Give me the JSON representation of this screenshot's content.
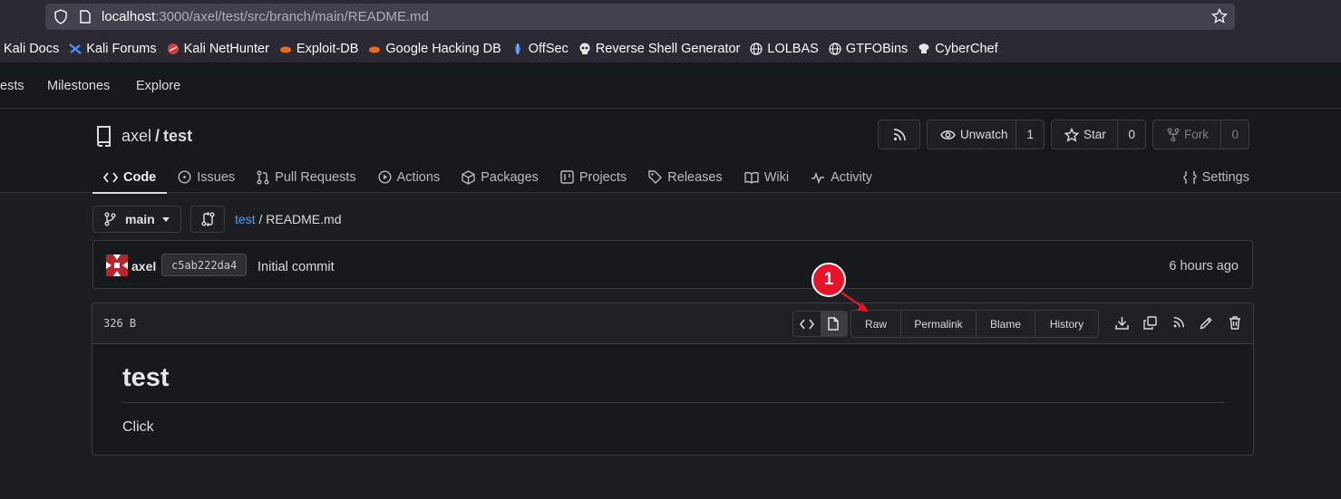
{
  "browser": {
    "url_host": "localhost",
    "url_path": ":3000/axel/test/src/branch/main/README.md",
    "bookmarks": [
      {
        "label": "Kali Docs",
        "icon": "kali-icon"
      },
      {
        "label": "Kali Forums",
        "icon": "kali-icon"
      },
      {
        "label": "Kali NetHunter",
        "icon": "nethunter-icon"
      },
      {
        "label": "Exploit-DB",
        "icon": "exploitdb-icon"
      },
      {
        "label": "Google Hacking DB",
        "icon": "exploitdb-icon"
      },
      {
        "label": "OffSec",
        "icon": "offsec-icon"
      },
      {
        "label": "Reverse Shell Generator",
        "icon": "skull-icon"
      },
      {
        "label": "LOLBAS",
        "icon": "globe-icon"
      },
      {
        "label": "GTFOBins",
        "icon": "globe-icon"
      },
      {
        "label": "CyberChef",
        "icon": "chef-icon"
      }
    ]
  },
  "nav": {
    "items": [
      "ests",
      "Milestones",
      "Explore"
    ]
  },
  "repo": {
    "owner": "axel",
    "separator": "/",
    "name": "test",
    "unwatch_label": "Unwatch",
    "watch_count": "1",
    "star_label": "Star",
    "star_count": "0",
    "fork_label": "Fork",
    "fork_count": "0"
  },
  "tabs": {
    "code": "Code",
    "issues": "Issues",
    "pull_requests": "Pull Requests",
    "actions": "Actions",
    "packages": "Packages",
    "projects": "Projects",
    "releases": "Releases",
    "wiki": "Wiki",
    "activity": "Activity",
    "settings": "Settings"
  },
  "branch": {
    "name": "main",
    "crumb_repo": "test",
    "crumb_sep": " / ",
    "crumb_file": "README.md"
  },
  "commit": {
    "author": "axel",
    "sha": "c5ab222da4",
    "message": "Initial commit",
    "time": "6 hours ago"
  },
  "file": {
    "size": "326 B",
    "actions": {
      "raw": "Raw",
      "permalink": "Permalink",
      "blame": "Blame",
      "history": "History"
    }
  },
  "readme": {
    "heading": "test",
    "body": "Click"
  },
  "annotation": {
    "number": "1",
    "color": "#e8132a"
  },
  "colors": {
    "link": "#4f9ee6",
    "background": "#1c1e21",
    "header_background": "#171a1c"
  }
}
